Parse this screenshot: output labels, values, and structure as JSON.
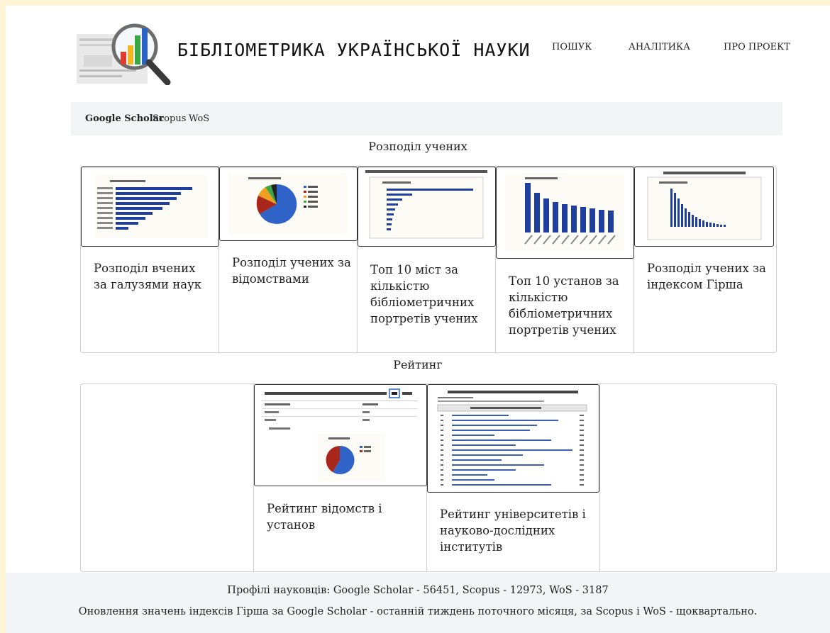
{
  "header": {
    "title": "БІБЛІОМЕТРИКА УКРАЇНСЬКОЇ НАУКИ",
    "nav": [
      "ПОШУК",
      "АНАЛІТИКА",
      "ПРО ПРОЕКТ"
    ]
  },
  "sources": [
    "Google Scholar",
    "Scopus",
    "WoS"
  ],
  "section_distribution": {
    "title": "Розподіл учених",
    "cards": [
      {
        "caption": "Розподіл вчених за галузями наук"
      },
      {
        "caption": "Розподіл учених за відомствами"
      },
      {
        "caption": "Топ 10 міст за кількістю бібліометричних портретів учених"
      },
      {
        "caption": "Топ 10 установ за кількістю бібліометричних портретів учених"
      },
      {
        "caption": "Розподіл учених за індексом Гірша"
      }
    ]
  },
  "section_rating": {
    "title": "Рейтинг",
    "cards": [
      {
        "caption": "Рейтинг відомств і установ"
      },
      {
        "caption": "Рейтинг університетів і науково-дослідних інститутів"
      }
    ]
  },
  "footer": {
    "line1": "Профілі науковців: Google Scholar - 56451, Scopus - 12973, WoS - 3187",
    "line2": "Оновлення значень індексів Гірша за Google Scholar - останній тиждень поточного місяця, за Scopus і WoS - щоквартально."
  },
  "colors": {
    "page_bg": "#fdf4d6",
    "panel_bg": "#f3f4f6",
    "bar_blue": "#1f3fa0"
  }
}
